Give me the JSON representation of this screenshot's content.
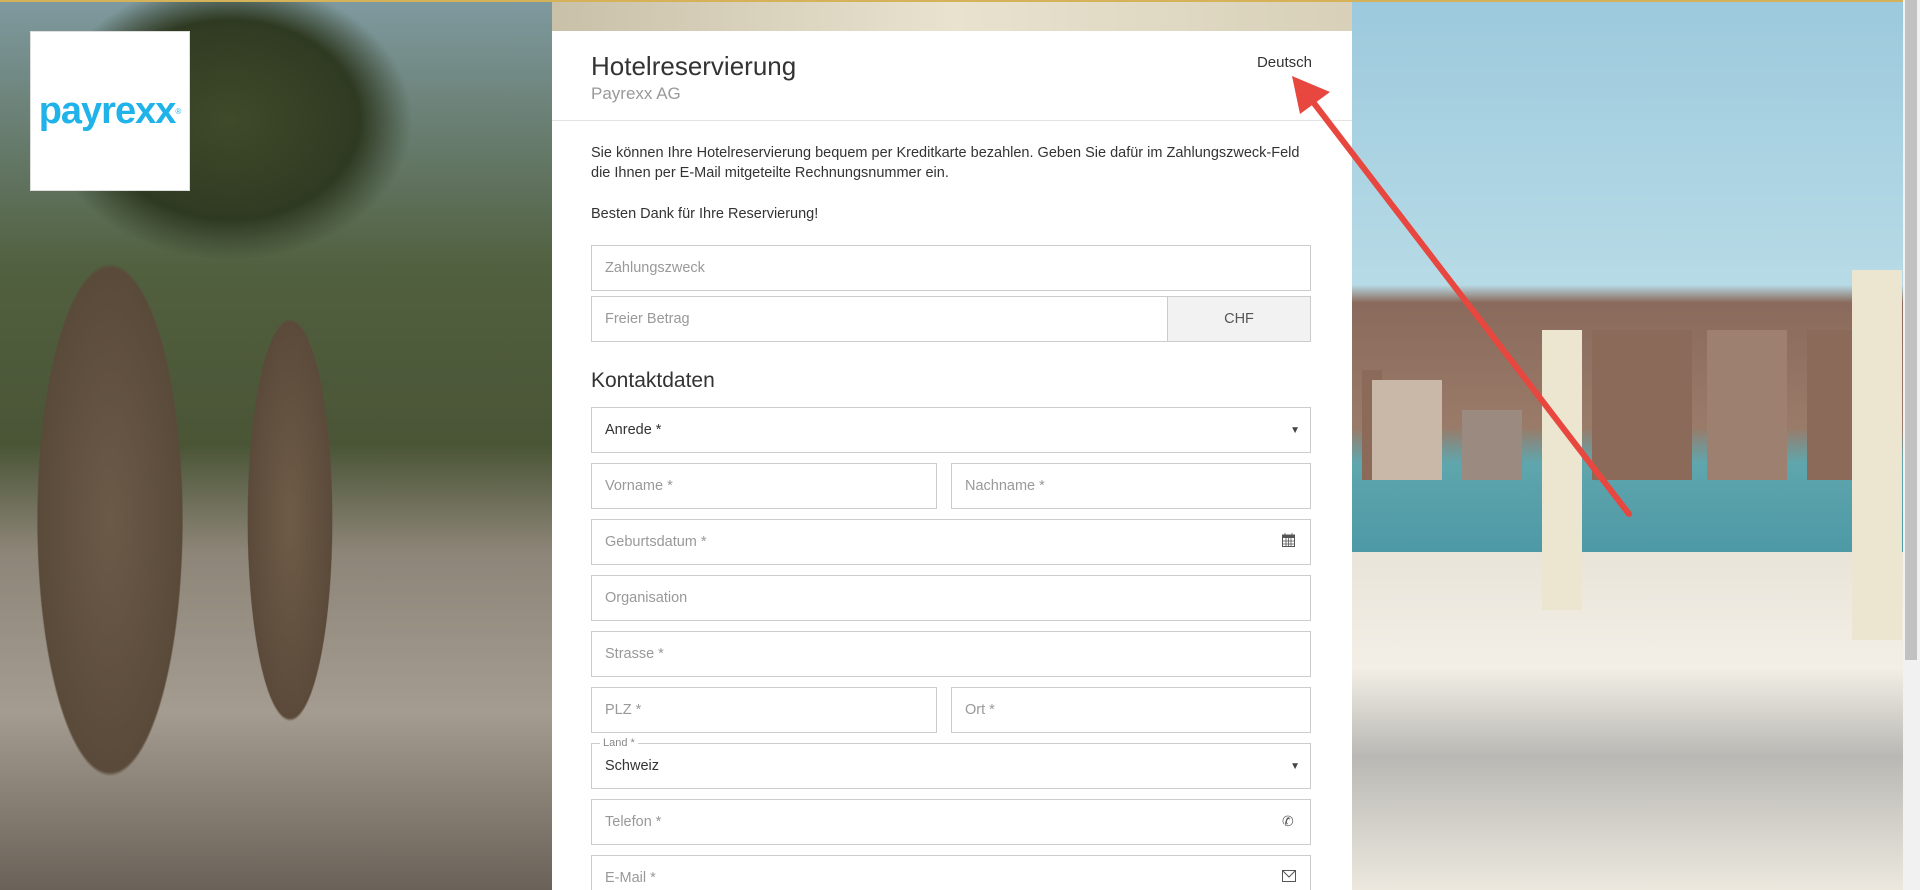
{
  "logo": {
    "text": "payrexx",
    "mark": "®"
  },
  "header": {
    "title": "Hotelreservierung",
    "subtitle": "Payrexx AG",
    "language": "Deutsch"
  },
  "intro": {
    "text": "Sie können Ihre Hotelreservierung bequem per Kreditkarte bezahlen. Geben Sie dafür im Zahlungszweck-Feld die Ihnen per E-Mail mitgeteilte Rechnungsnummer ein.",
    "thanks": "Besten Dank für Ihre Reservierung!"
  },
  "payment": {
    "purpose_placeholder": "Zahlungszweck",
    "amount_placeholder": "Freier Betrag",
    "currency": "CHF"
  },
  "contact": {
    "heading": "Kontaktdaten",
    "salutation": "Anrede *",
    "first_name": "Vorname *",
    "last_name": "Nachname *",
    "birthdate": "Geburtsdatum *",
    "organisation": "Organisation",
    "street": "Strasse *",
    "zip": "PLZ *",
    "city": "Ort *",
    "country_label": "Land *",
    "country_value": "Schweiz",
    "phone": "Telefon *",
    "email": "E-Mail *"
  },
  "colors": {
    "brand": "#1fb3ea",
    "annotation_arrow": "#e8473f"
  }
}
